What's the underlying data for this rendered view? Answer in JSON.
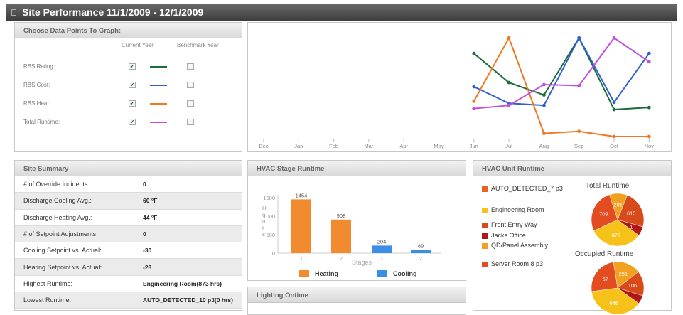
{
  "window": {
    "title": "Site Performance 11/1/2009 - 12/1/2009"
  },
  "choose": {
    "title": "Choose Data Points To Graph:",
    "col_current": "Current Year",
    "col_benchmark": "Benchmark Year",
    "rows": [
      {
        "label": "RBS Rating:",
        "current": true,
        "benchmark": false,
        "color": "#1f6b3a"
      },
      {
        "label": "RBS Cost:",
        "current": true,
        "benchmark": false,
        "color": "#3060d0"
      },
      {
        "label": "RBS Heat:",
        "current": true,
        "benchmark": false,
        "color": "#f07820"
      },
      {
        "label": "Total Runtime:",
        "current": true,
        "benchmark": false,
        "color": "#c050e0"
      }
    ]
  },
  "linechart": {
    "chart_data": {
      "type": "line",
      "categories": [
        "Dec",
        "Jan",
        "Feb",
        "Mar",
        "Apr",
        "May",
        "Jun",
        "Jul",
        "Aug",
        "Sep",
        "Oct",
        "Nov"
      ],
      "ylim": [
        0,
        100
      ],
      "series": [
        {
          "color": "#1f6b3a",
          "values": [
            null,
            null,
            null,
            null,
            null,
            null,
            80,
            52,
            40,
            95,
            26,
            28
          ]
        },
        {
          "color": "#3060d0",
          "values": [
            null,
            null,
            null,
            null,
            null,
            null,
            48,
            32,
            30,
            95,
            33,
            80
          ]
        },
        {
          "color": "#f07820",
          "values": [
            null,
            null,
            null,
            null,
            null,
            null,
            34,
            95,
            3,
            5,
            0,
            0
          ]
        },
        {
          "color": "#c050e0",
          "values": [
            null,
            null,
            null,
            null,
            null,
            null,
            27,
            30,
            50,
            49,
            95,
            72
          ]
        }
      ]
    }
  },
  "summary": {
    "title": "Site Summary",
    "rows": [
      {
        "label": "# of Override Incidents:",
        "value": "0"
      },
      {
        "label": "Discharge Cooling Avg.:",
        "value": "60 °F"
      },
      {
        "label": "Discharge Heating Avg.:",
        "value": "44 °F"
      },
      {
        "label": "# of Setpoint Adjustments:",
        "value": "0"
      },
      {
        "label": "Cooling Setpoint vs. Actual:",
        "value": "-30"
      },
      {
        "label": "Heating Setpoint vs. Actual:",
        "value": "-28"
      },
      {
        "label": "Highest Runtime:",
        "value": "Engineering Room(873 hrs)"
      },
      {
        "label": "Lowest Runtime:",
        "value": "AUTO_DETECTED_10 p3(0 hrs)"
      }
    ]
  },
  "stage": {
    "title": "HVAC Stage Runtime",
    "chart_data": {
      "type": "bar",
      "categories": [
        "1",
        "2",
        "1",
        "2"
      ],
      "values": [
        1454,
        908,
        204,
        89
      ],
      "bar_series": [
        "Heating",
        "Heating",
        "Cooling",
        "Cooling"
      ],
      "ylabel": "H o u r s",
      "xlabel": "Stages",
      "ylim": [
        0,
        1500
      ],
      "yticks": [
        "1500",
        "1000",
        "500",
        "0"
      ],
      "legend": [
        {
          "name": "Heating",
          "color": "#f28a30"
        },
        {
          "name": "Cooling",
          "color": "#3a8ee6"
        }
      ]
    }
  },
  "lighting": {
    "title": "Lighting Ontime"
  },
  "unit": {
    "title": "HVAC Unit Runtime",
    "legend": [
      {
        "label": "AUTO_DETECTED_7 p3",
        "color": "#e8622a"
      },
      {
        "label": "Engineering Room",
        "color": "#f6c21a"
      },
      {
        "label": "Front Entry Way",
        "color": "#d84a1a"
      },
      {
        "label": "Jacks Office",
        "color": "#b01818"
      },
      {
        "label": "QD/Panel Assembly",
        "color": "#f2a020"
      },
      {
        "label": "Server Room 8 p3",
        "color": "#e24c20"
      }
    ],
    "total": {
      "title": "Total  Runtime",
      "chart_data": {
        "type": "pie",
        "slices": [
          {
            "label": "873",
            "value": 873,
            "color": "#f6c21a"
          },
          {
            "label": "709",
            "value": 709,
            "color": "#e24c20"
          },
          {
            "label": "291",
            "value": 291,
            "color": "#f2a020"
          },
          {
            "label": "615",
            "value": 615,
            "color": "#d84a1a"
          },
          {
            "label": "1",
            "value": 150,
            "color": "#b01818"
          }
        ]
      }
    },
    "occupied": {
      "title": "Occupied  Runtime",
      "chart_data": {
        "type": "pie",
        "slices": [
          {
            "label": "646",
            "value": 646,
            "color": "#f6c21a"
          },
          {
            "label": "67",
            "value": 420,
            "color": "#e24c20"
          },
          {
            "label": "291",
            "value": 291,
            "color": "#f2a020"
          },
          {
            "label": "106",
            "value": 260,
            "color": "#d84a1a"
          },
          {
            "label": "",
            "value": 90,
            "color": "#b01818"
          }
        ]
      }
    }
  }
}
